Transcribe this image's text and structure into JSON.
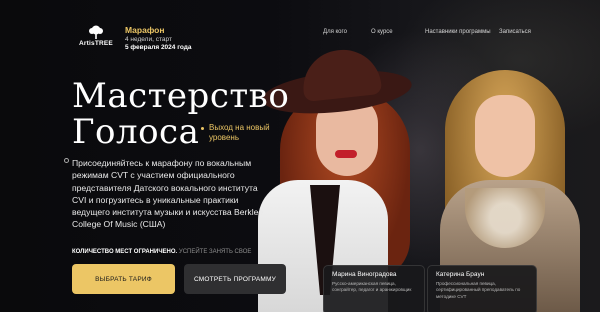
{
  "colors": {
    "accent": "#ecc665",
    "background": "#0b0b0d",
    "secondary_button": "#2f2f31"
  },
  "logo": {
    "text": "ArtisTREE",
    "icon": "tree-icon"
  },
  "marathon": {
    "title": "Марафон",
    "subtitle": "4 недели, старт",
    "date": "5 февраля 2024 года"
  },
  "nav": {
    "items": [
      "Для кого",
      "О курсе",
      "Наставники программы",
      "Записаться"
    ]
  },
  "hero": {
    "title_line1": "Мастерство",
    "title_line2": "Голоса",
    "tagline": "Выход на новый уровень",
    "description": "Присоединяйтесь к марафону по вокальным режимам CVT с участием официального представителя Датского вокального института CVI и погрузитесь в уникальные практики ведущего института музыки и искусства Berklee College Of Music (США)"
  },
  "limit": {
    "strong": "КОЛИЧЕСТВО МЕСТ ОГРАНИЧЕНО.",
    "muted": "УСПЕЙТЕ ЗАНЯТЬ СВОЕ"
  },
  "buttons": {
    "primary": "ВЫБРАТЬ ТАРИФ",
    "secondary": "СМОТРЕТЬ ПРОГРАММУ"
  },
  "mentors": [
    {
      "name": "Марина Виноградова",
      "desc": "Русско-американская певица, сонграйтер, педагог и аранжировщик"
    },
    {
      "name": "Катерина Браун",
      "desc": "Профессиональная певица, сертифицированный преподаватель по методике CVT"
    }
  ]
}
